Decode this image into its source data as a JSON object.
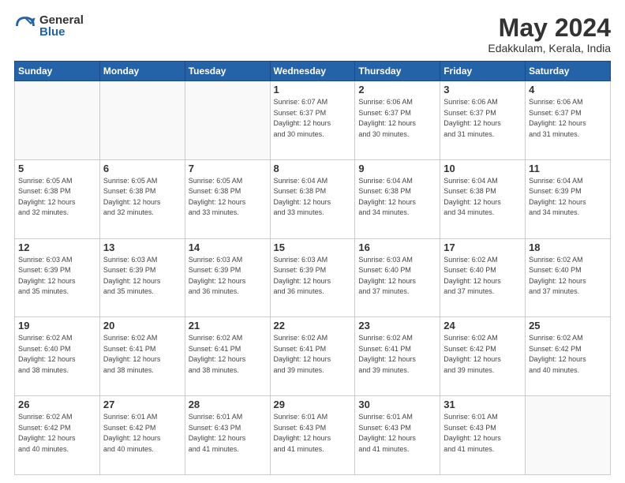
{
  "logo": {
    "general": "General",
    "blue": "Blue"
  },
  "title": "May 2024",
  "location": "Edakkulam, Kerala, India",
  "days_of_week": [
    "Sunday",
    "Monday",
    "Tuesday",
    "Wednesday",
    "Thursday",
    "Friday",
    "Saturday"
  ],
  "weeks": [
    [
      {
        "day": "",
        "info": ""
      },
      {
        "day": "",
        "info": ""
      },
      {
        "day": "",
        "info": ""
      },
      {
        "day": "1",
        "info": "Sunrise: 6:07 AM\nSunset: 6:37 PM\nDaylight: 12 hours\nand 30 minutes."
      },
      {
        "day": "2",
        "info": "Sunrise: 6:06 AM\nSunset: 6:37 PM\nDaylight: 12 hours\nand 30 minutes."
      },
      {
        "day": "3",
        "info": "Sunrise: 6:06 AM\nSunset: 6:37 PM\nDaylight: 12 hours\nand 31 minutes."
      },
      {
        "day": "4",
        "info": "Sunrise: 6:06 AM\nSunset: 6:37 PM\nDaylight: 12 hours\nand 31 minutes."
      }
    ],
    [
      {
        "day": "5",
        "info": "Sunrise: 6:05 AM\nSunset: 6:38 PM\nDaylight: 12 hours\nand 32 minutes."
      },
      {
        "day": "6",
        "info": "Sunrise: 6:05 AM\nSunset: 6:38 PM\nDaylight: 12 hours\nand 32 minutes."
      },
      {
        "day": "7",
        "info": "Sunrise: 6:05 AM\nSunset: 6:38 PM\nDaylight: 12 hours\nand 33 minutes."
      },
      {
        "day": "8",
        "info": "Sunrise: 6:04 AM\nSunset: 6:38 PM\nDaylight: 12 hours\nand 33 minutes."
      },
      {
        "day": "9",
        "info": "Sunrise: 6:04 AM\nSunset: 6:38 PM\nDaylight: 12 hours\nand 34 minutes."
      },
      {
        "day": "10",
        "info": "Sunrise: 6:04 AM\nSunset: 6:38 PM\nDaylight: 12 hours\nand 34 minutes."
      },
      {
        "day": "11",
        "info": "Sunrise: 6:04 AM\nSunset: 6:39 PM\nDaylight: 12 hours\nand 34 minutes."
      }
    ],
    [
      {
        "day": "12",
        "info": "Sunrise: 6:03 AM\nSunset: 6:39 PM\nDaylight: 12 hours\nand 35 minutes."
      },
      {
        "day": "13",
        "info": "Sunrise: 6:03 AM\nSunset: 6:39 PM\nDaylight: 12 hours\nand 35 minutes."
      },
      {
        "day": "14",
        "info": "Sunrise: 6:03 AM\nSunset: 6:39 PM\nDaylight: 12 hours\nand 36 minutes."
      },
      {
        "day": "15",
        "info": "Sunrise: 6:03 AM\nSunset: 6:39 PM\nDaylight: 12 hours\nand 36 minutes."
      },
      {
        "day": "16",
        "info": "Sunrise: 6:03 AM\nSunset: 6:40 PM\nDaylight: 12 hours\nand 37 minutes."
      },
      {
        "day": "17",
        "info": "Sunrise: 6:02 AM\nSunset: 6:40 PM\nDaylight: 12 hours\nand 37 minutes."
      },
      {
        "day": "18",
        "info": "Sunrise: 6:02 AM\nSunset: 6:40 PM\nDaylight: 12 hours\nand 37 minutes."
      }
    ],
    [
      {
        "day": "19",
        "info": "Sunrise: 6:02 AM\nSunset: 6:40 PM\nDaylight: 12 hours\nand 38 minutes."
      },
      {
        "day": "20",
        "info": "Sunrise: 6:02 AM\nSunset: 6:41 PM\nDaylight: 12 hours\nand 38 minutes."
      },
      {
        "day": "21",
        "info": "Sunrise: 6:02 AM\nSunset: 6:41 PM\nDaylight: 12 hours\nand 38 minutes."
      },
      {
        "day": "22",
        "info": "Sunrise: 6:02 AM\nSunset: 6:41 PM\nDaylight: 12 hours\nand 39 minutes."
      },
      {
        "day": "23",
        "info": "Sunrise: 6:02 AM\nSunset: 6:41 PM\nDaylight: 12 hours\nand 39 minutes."
      },
      {
        "day": "24",
        "info": "Sunrise: 6:02 AM\nSunset: 6:42 PM\nDaylight: 12 hours\nand 39 minutes."
      },
      {
        "day": "25",
        "info": "Sunrise: 6:02 AM\nSunset: 6:42 PM\nDaylight: 12 hours\nand 40 minutes."
      }
    ],
    [
      {
        "day": "26",
        "info": "Sunrise: 6:02 AM\nSunset: 6:42 PM\nDaylight: 12 hours\nand 40 minutes."
      },
      {
        "day": "27",
        "info": "Sunrise: 6:01 AM\nSunset: 6:42 PM\nDaylight: 12 hours\nand 40 minutes."
      },
      {
        "day": "28",
        "info": "Sunrise: 6:01 AM\nSunset: 6:43 PM\nDaylight: 12 hours\nand 41 minutes."
      },
      {
        "day": "29",
        "info": "Sunrise: 6:01 AM\nSunset: 6:43 PM\nDaylight: 12 hours\nand 41 minutes."
      },
      {
        "day": "30",
        "info": "Sunrise: 6:01 AM\nSunset: 6:43 PM\nDaylight: 12 hours\nand 41 minutes."
      },
      {
        "day": "31",
        "info": "Sunrise: 6:01 AM\nSunset: 6:43 PM\nDaylight: 12 hours\nand 41 minutes."
      },
      {
        "day": "",
        "info": ""
      }
    ]
  ]
}
